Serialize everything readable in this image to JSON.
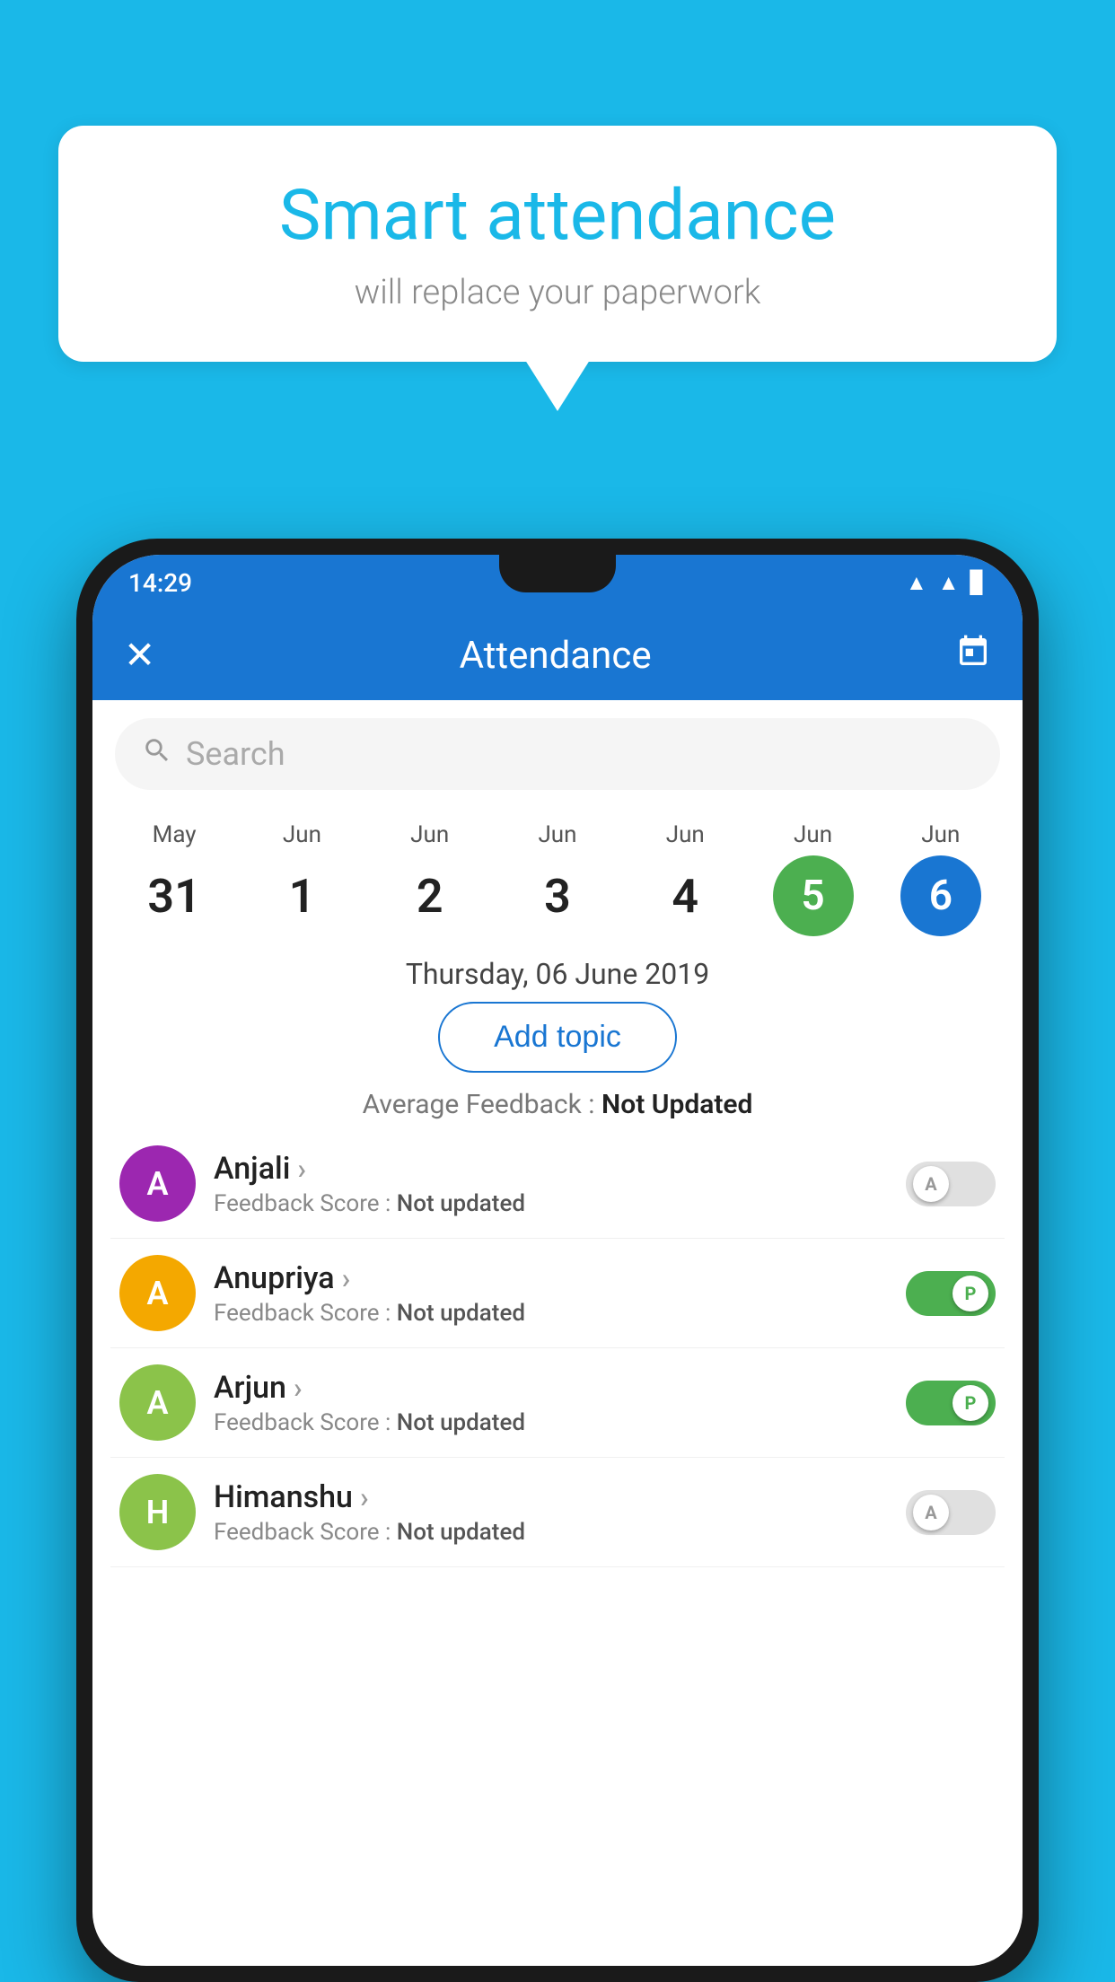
{
  "background_color": "#1ab8e8",
  "bubble": {
    "title": "Smart attendance",
    "subtitle": "will replace your paperwork"
  },
  "status_bar": {
    "time": "14:29"
  },
  "header": {
    "close_icon": "✕",
    "title": "Attendance",
    "calendar_icon": "📅"
  },
  "search": {
    "placeholder": "Search"
  },
  "calendar": {
    "days": [
      {
        "month": "May",
        "date": "31",
        "style": "normal"
      },
      {
        "month": "Jun",
        "date": "1",
        "style": "normal"
      },
      {
        "month": "Jun",
        "date": "2",
        "style": "normal"
      },
      {
        "month": "Jun",
        "date": "3",
        "style": "normal"
      },
      {
        "month": "Jun",
        "date": "4",
        "style": "normal"
      },
      {
        "month": "Jun",
        "date": "5",
        "style": "today"
      },
      {
        "month": "Jun",
        "date": "6",
        "style": "selected"
      }
    ]
  },
  "selected_date": "Thursday, 06 June 2019",
  "add_topic_label": "Add topic",
  "avg_feedback_label": "Average Feedback :",
  "avg_feedback_value": "Not Updated",
  "students": [
    {
      "name": "Anjali",
      "initial": "A",
      "avatar_color": "purple",
      "feedback_label": "Feedback Score :",
      "feedback_value": "Not updated",
      "toggle_state": "off",
      "toggle_label": "A"
    },
    {
      "name": "Anupriya",
      "initial": "A",
      "avatar_color": "yellow",
      "feedback_label": "Feedback Score :",
      "feedback_value": "Not updated",
      "toggle_state": "on",
      "toggle_label": "P"
    },
    {
      "name": "Arjun",
      "initial": "A",
      "avatar_color": "light-green",
      "feedback_label": "Feedback Score :",
      "feedback_value": "Not updated",
      "toggle_state": "on",
      "toggle_label": "P"
    },
    {
      "name": "Himanshu",
      "initial": "H",
      "avatar_color": "light-green",
      "feedback_label": "Feedback Score :",
      "feedback_value": "Not updated",
      "toggle_state": "off",
      "toggle_label": "A"
    }
  ]
}
